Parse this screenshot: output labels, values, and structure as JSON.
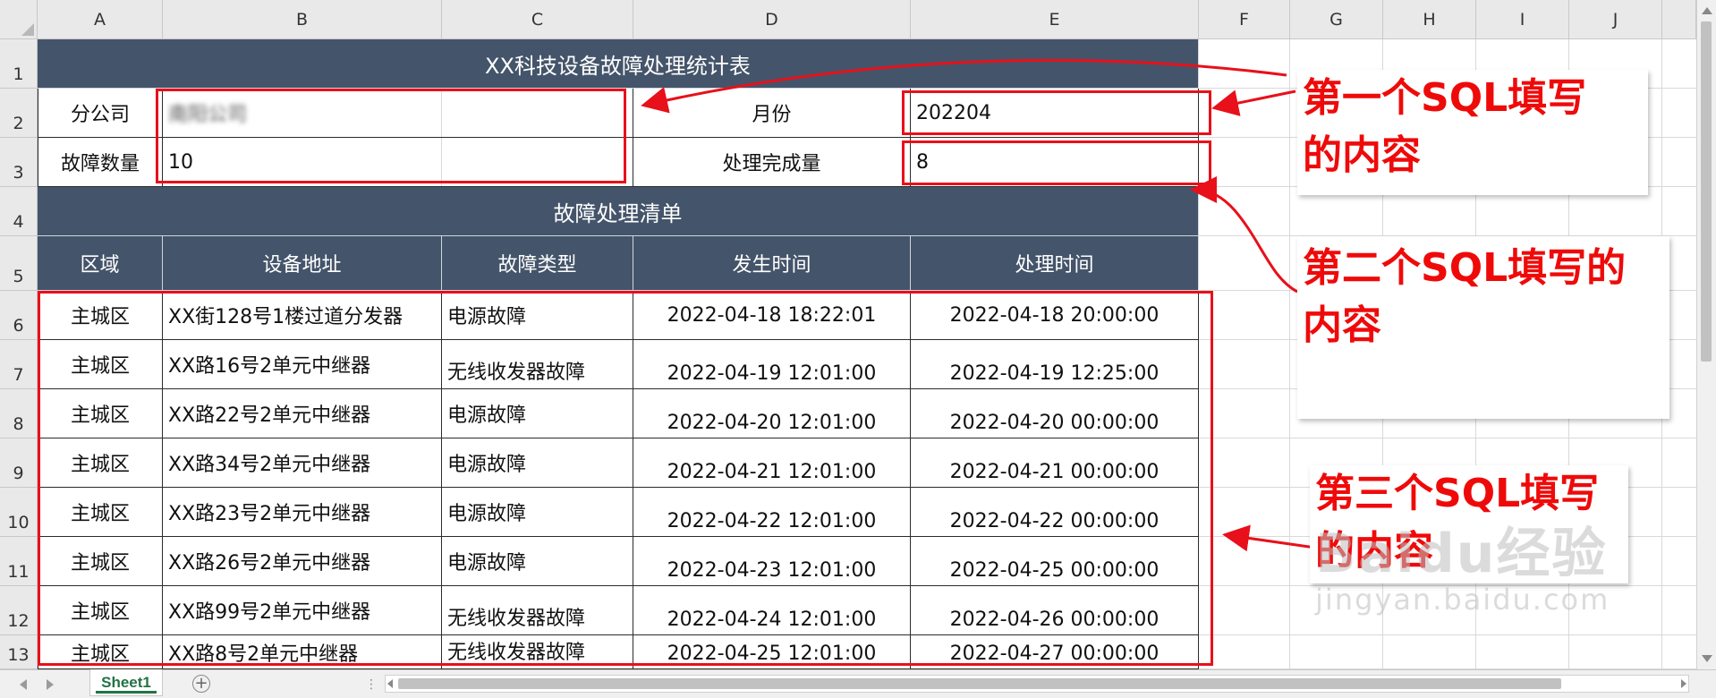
{
  "columns": [
    "A",
    "B",
    "C",
    "D",
    "E",
    "F",
    "G",
    "H",
    "I",
    "J"
  ],
  "rows": [
    "1",
    "2",
    "3",
    "4",
    "5",
    "6",
    "7",
    "8",
    "9",
    "10",
    "11",
    "12",
    "13"
  ],
  "title": "XX科技设备故障处理统计表",
  "info": {
    "branch_label": "分公司",
    "branch_value": "南阳公司",
    "month_label": "月份",
    "month_value": "202204",
    "fault_count_label": "故障数量",
    "fault_count_value": "10",
    "completed_label": "处理完成量",
    "completed_value": "8"
  },
  "list_title": "故障处理清单",
  "table": {
    "headers": [
      "区域",
      "设备地址",
      "故障类型",
      "发生时间",
      "处理时间"
    ],
    "rows": [
      [
        "主城区",
        "XX街128号1楼过道分发器",
        "电源故障",
        "2022-04-18 18:22:01",
        "2022-04-18 20:00:00"
      ],
      [
        "主城区",
        "XX路16号2单元中继器",
        "无线收发器故障",
        "2022-04-19 12:01:00",
        "2022-04-19 12:25:00"
      ],
      [
        "主城区",
        "XX路22号2单元中继器",
        "电源故障",
        "2022-04-20 12:01:00",
        "2022-04-20 00:00:00"
      ],
      [
        "主城区",
        "XX路34号2单元中继器",
        "电源故障",
        "2022-04-21 12:01:00",
        "2022-04-21 00:00:00"
      ],
      [
        "主城区",
        "XX路23号2单元中继器",
        "电源故障",
        "2022-04-22 12:01:00",
        "2022-04-22 00:00:00"
      ],
      [
        "主城区",
        "XX路26号2单元中继器",
        "电源故障",
        "2022-04-23 12:01:00",
        "2022-04-25 00:00:00"
      ],
      [
        "主城区",
        "XX路99号2单元中继器",
        "无线收发器故障",
        "2022-04-24 12:01:00",
        "2022-04-26 00:00:00"
      ],
      [
        "主城区",
        "XX路8号2单元中继器",
        "无线收发器故障",
        "2022-04-25 12:01:00",
        "2022-04-27 00:00:00"
      ]
    ]
  },
  "annotations": {
    "first": "第一个SQL填写的内容",
    "second": "第二个SQL填写的内容",
    "third": "第三个SQL填写的内容"
  },
  "watermark": {
    "main": "Baidu经验",
    "sub": "jingyan.baidu.com"
  },
  "sheet_tab": "Sheet1",
  "add_sheet_symbol": "+",
  "colors": {
    "header_fill": "#44546a",
    "annotation_red": "#e8101a",
    "tab_green": "#217346"
  }
}
